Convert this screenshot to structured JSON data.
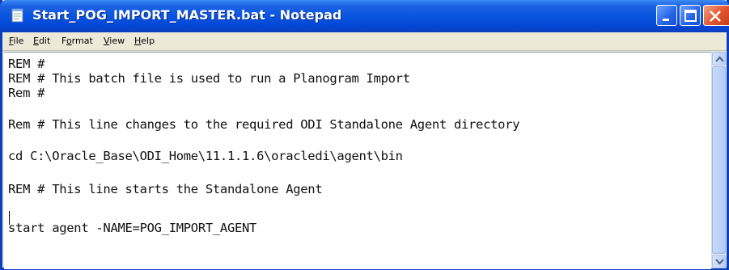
{
  "window": {
    "title": "Start_POG_IMPORT_MASTER.bat - Notepad",
    "app_icon": "notepad-icon",
    "controls": [
      "minimize-icon",
      "maximize-icon",
      "close-icon"
    ]
  },
  "menu": {
    "items": [
      {
        "key": "F",
        "rest": "ile"
      },
      {
        "key": "E",
        "rest": "dit"
      },
      {
        "key": "o",
        "pre": "F",
        "rest": "rmat"
      },
      {
        "key": "V",
        "rest": "iew"
      },
      {
        "key": "H",
        "rest": "elp"
      }
    ]
  },
  "editor": {
    "lines": [
      "REM #",
      "REM # This batch file is used to run a Planogram Import",
      "Rem #",
      "Rem # This line changes to the required ODI Standalone Agent directory",
      "cd C:\\Oracle_Base\\ODI_Home\\11.1.1.6\\oracledi\\agent\\bin",
      "REM # This line starts the Standalone Agent",
      "start agent -NAME=POG_IMPORT_AGENT"
    ]
  },
  "colors": {
    "titlebar": "#0a55e0",
    "close_button": "#e0552f",
    "menubar": "#ece9d8"
  }
}
